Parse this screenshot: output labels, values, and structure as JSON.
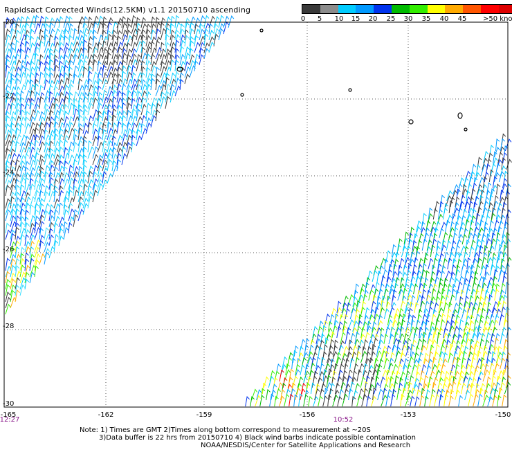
{
  "title": "Rapidsact Corrected Winds(12.5KM) v1.1 20150710 ascending",
  "legend": {
    "colors": [
      "#3a3a3a",
      "#8c8c8c",
      "#00ccff",
      "#0099ff",
      "#0033ee",
      "#00bb00",
      "#33ee00",
      "#ffff00",
      "#ffaa00",
      "#ff5500",
      "#ff0000",
      "#dd0000",
      "#7a3a1a",
      "#c0c0c0",
      "#ff00ff",
      "#cc00ff",
      "#7a00cc",
      "#330066"
    ],
    "labels": [
      "0",
      "5",
      "10",
      "15",
      "20",
      "25",
      "30",
      "35",
      "40",
      "45",
      ">50 knots"
    ],
    "unit": "knots"
  },
  "axes": {
    "y_labels": [
      "-20",
      "-22",
      "-24",
      "-26",
      "-28",
      "-30"
    ],
    "x_labels": [
      "-165",
      "-162",
      "-159",
      "-156",
      "-153",
      "-150"
    ]
  },
  "times": [
    "12:27",
    "10:52"
  ],
  "notes": [
    "Note: 1) Times are GMT 2)Times along bottom correspond to measurement at ~20S",
    "3)Data buffer is 22 hrs from 20150710 4) Black wind barbs indicate possible contamination",
    "NOAA/NESDIS/Center for Satellite Applications and Research"
  ]
}
